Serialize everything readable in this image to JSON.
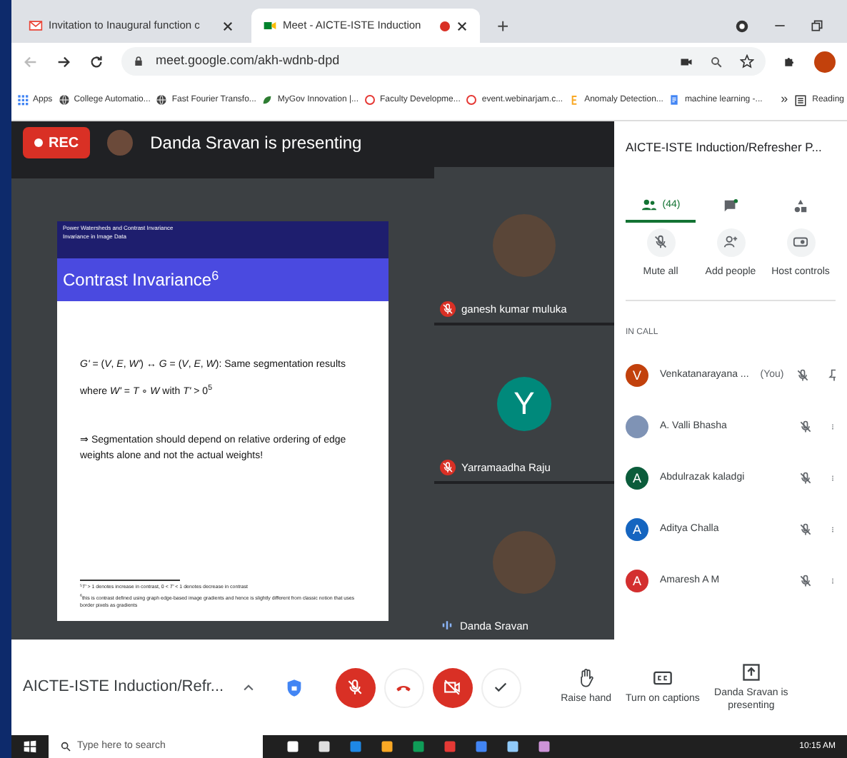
{
  "browser": {
    "tabs": [
      {
        "title": "Invitation to Inaugural function c",
        "selected": false,
        "recording": false
      },
      {
        "title": "Meet - AICTE-ISTE Induction",
        "selected": true,
        "recording": true
      }
    ],
    "new_tab": "+",
    "url": "meet.google.com/akh-wdnb-dpd",
    "bookmarks": [
      {
        "label": "Apps",
        "kind": "grid"
      },
      {
        "label": "College Automatio...",
        "kind": "globe"
      },
      {
        "label": "Fast Fourier Transfo...",
        "kind": "globe"
      },
      {
        "label": "MyGov Innovation |...",
        "kind": "leaf"
      },
      {
        "label": "Faculty Developme...",
        "kind": "ring"
      },
      {
        "label": "event.webinarjam.c...",
        "kind": "ring"
      },
      {
        "label": "Anomaly Detection...",
        "kind": "letter"
      },
      {
        "label": "machine learning -...",
        "kind": "doc"
      }
    ],
    "more": "»",
    "reading_list": "Reading"
  },
  "meet": {
    "rec": "REC",
    "presenter": "Danda Sravan is presenting",
    "slide": {
      "header": "Power Watersheds and Contrast Invariance",
      "subheader": "Invariance in Image Data",
      "title": "Contrast Invariance$^{6}$",
      "lines": [
        "*G'* = (*V*, *E*, *W'*) ↔ *G* = (*V*, *E*, *W*): Same segmentation results",
        "where *W'* = *T* ∘ *W* with *T'* > 0$^{5}$",
        "⇒ Segmentation should depend on relative ordering of edge weights alone and not the actual weights!"
      ],
      "footnotes": [
        "$^{5}$*T'* > 1 denotes increase in contrast, 0 < *T'* < 1 denotes decrease in contrast",
        "$^{6}$this is contrast defined using graph edge-based image gradients and hence is slightly different from classic notion that uses border pixels as gradients"
      ]
    },
    "tiles": [
      {
        "name": "ganesh kumar muluka",
        "muted": true
      },
      {
        "name": "Yarramaadha Raju",
        "initial": "Y",
        "color": "#00897b",
        "muted": true
      },
      {
        "name": "Danda Sravan",
        "muted": false
      }
    ]
  },
  "panel": {
    "title": "AICTE-ISTE Induction/Refresher P...",
    "tabs": [
      {
        "kind": "people",
        "label": "(44)",
        "selected": true
      },
      {
        "kind": "chat",
        "selected": false
      },
      {
        "kind": "activities",
        "selected": false
      }
    ],
    "actions": [
      {
        "kind": "mute",
        "label": "Mute all"
      },
      {
        "kind": "add",
        "label": "Add people"
      },
      {
        "kind": "host",
        "label": "Host controls"
      }
    ],
    "section": "IN CALL",
    "people": [
      {
        "name": "Venkatanarayana ...",
        "tag": "(You)",
        "initial": "V",
        "color": "#c2410c",
        "kind": "pin"
      },
      {
        "name": "A. Valli Bhasha",
        "kind": "more"
      },
      {
        "name": "Abdulrazak kaladgi",
        "initial": "A",
        "color": "#0b5c3b",
        "kind": "more"
      },
      {
        "name": "Aditya Challa",
        "initial": "A",
        "color": "#1565c0",
        "kind": "more"
      },
      {
        "name": "Amaresh A M",
        "initial": "A",
        "color": "#d32f2f",
        "kind": "more"
      }
    ]
  },
  "bottom": {
    "meeting": "AICTE-ISTE Induction/Refr...",
    "controls": [
      {
        "kind": "mic",
        "on": false
      },
      {
        "kind": "hangup"
      },
      {
        "kind": "camera",
        "on": false
      },
      {
        "kind": "check"
      }
    ],
    "actions": [
      {
        "kind": "hand",
        "label": "Raise hand"
      },
      {
        "kind": "captions",
        "label": "Turn on captions"
      },
      {
        "kind": "present",
        "label": "Danda Sravan is presenting"
      }
    ]
  },
  "taskbar": {
    "search": "Type here to search",
    "time": "10:15 AM"
  }
}
